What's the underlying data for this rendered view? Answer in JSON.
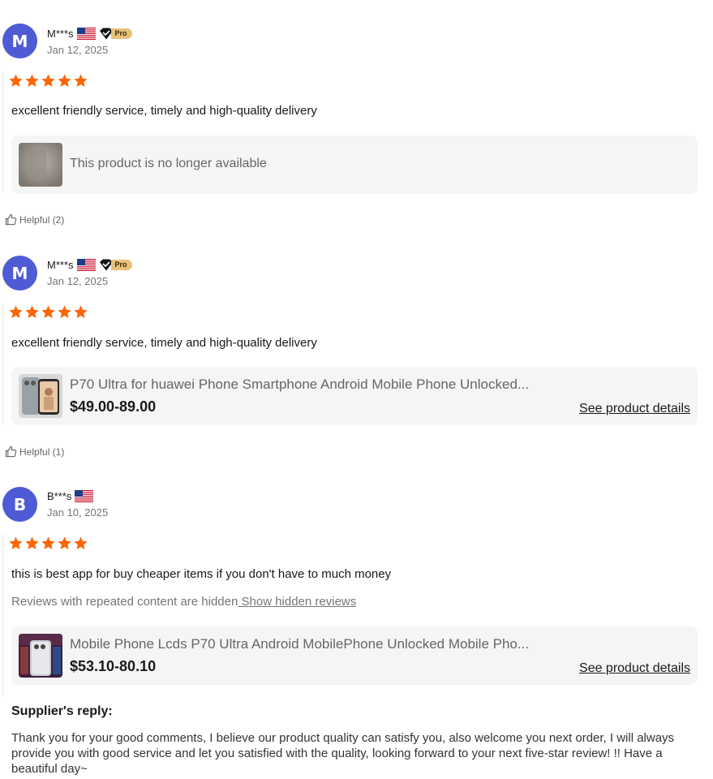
{
  "reviews": [
    {
      "initial": "M",
      "username": "M***s",
      "badge": "Pro",
      "date": "Jan 12, 2025",
      "text": "excellent friendly service, timely and high-quality delivery",
      "product_unavailable": "This product is no longer available",
      "helpful": "Helpful (2)"
    },
    {
      "initial": "M",
      "username": "M***s",
      "badge": "Pro",
      "date": "Jan 12, 2025",
      "text": "excellent friendly service, timely and high-quality delivery",
      "product_title": "P70 Ultra for huawei Phone Smartphone Android Mobile Phone Unlocked...",
      "product_price": "$49.00-89.00",
      "see_details": "See product details",
      "helpful": "Helpful (1)"
    },
    {
      "initial": "B",
      "username": "B***s",
      "date": "Jan 10, 2025",
      "text": "this is best app for buy cheaper items if you don't have to much money",
      "hidden_note": "Reviews with repeated content are hidden",
      "show_hidden": " Show hidden reviews",
      "product_title": "Mobile Phone Lcds P70 Ultra Android MobilePhone Unlocked Mobile Pho...",
      "product_price": "$53.10-80.10",
      "see_details": "See product details",
      "supplier_reply_title": "Supplier's reply:",
      "supplier_reply": "Thank you for your good comments, I believe our product quality can satisfy you, also welcome you next order, I will always provide you with good service and let you satisfied with the quality, looking forward to your next five-star review! !! Have a beautiful day~"
    }
  ],
  "rating": {
    "stars": 5,
    "max": 5
  },
  "colors": {
    "star": "#fd6505",
    "avatar": "#4f5bd5",
    "card_bg": "#f5f5f5",
    "pro_badge": "#e8c07a"
  },
  "icons": {
    "flag": "us-flag-icon",
    "pro": "diamond-pro-icon",
    "helpful": "thumbs-up-icon",
    "star": "star-icon"
  }
}
